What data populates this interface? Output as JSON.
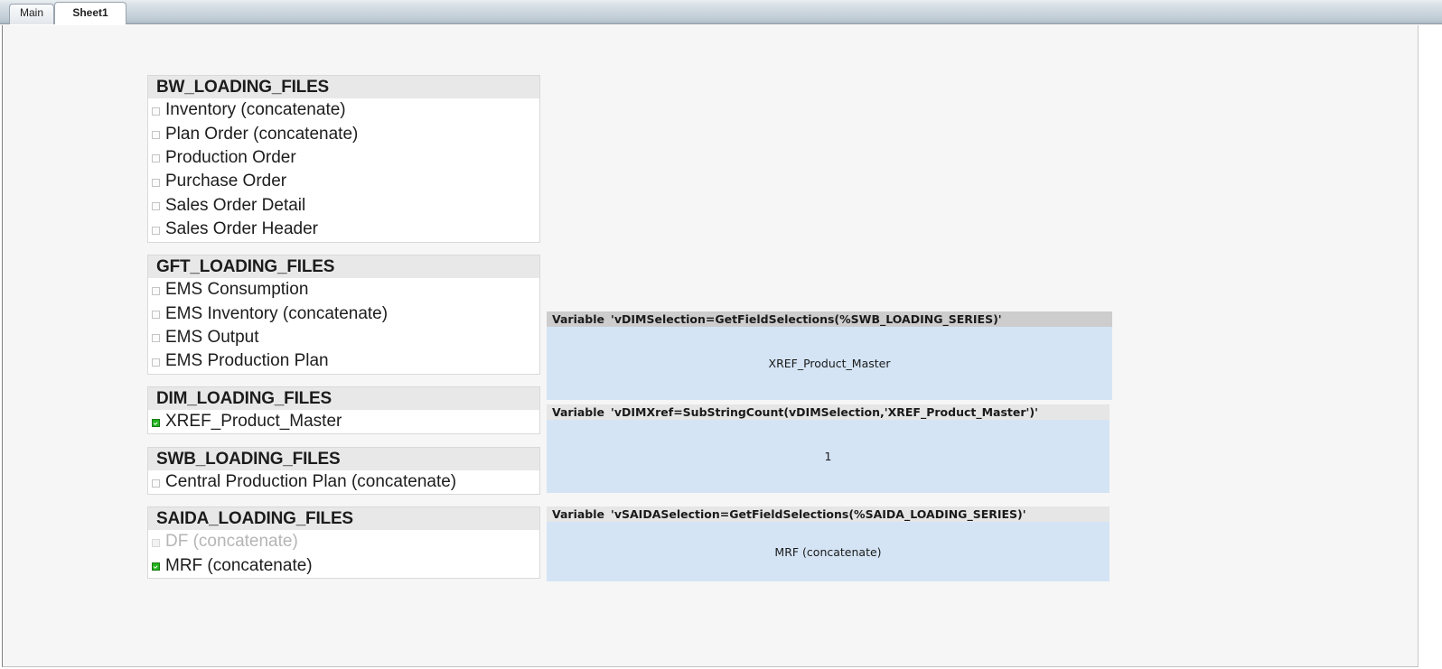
{
  "window": {
    "tabs": [
      {
        "label": "Main",
        "active": false
      },
      {
        "label": "Sheet1",
        "active": true
      }
    ]
  },
  "listboxes": [
    {
      "caption": "BW_LOADING_FILES",
      "items": [
        {
          "label": "Inventory (concatenate)",
          "state": "optional"
        },
        {
          "label": "Plan Order (concatenate)",
          "state": "optional"
        },
        {
          "label": "Production Order",
          "state": "optional"
        },
        {
          "label": "Purchase Order",
          "state": "optional"
        },
        {
          "label": "Sales Order Detail",
          "state": "optional"
        },
        {
          "label": "Sales Order Header",
          "state": "optional"
        }
      ]
    },
    {
      "caption": "GFT_LOADING_FILES",
      "items": [
        {
          "label": "EMS Consumption",
          "state": "optional"
        },
        {
          "label": "EMS Inventory (concatenate)",
          "state": "optional"
        },
        {
          "label": "EMS Output",
          "state": "optional"
        },
        {
          "label": "EMS Production Plan",
          "state": "optional"
        }
      ]
    },
    {
      "caption": "DIM_LOADING_FILES",
      "items": [
        {
          "label": "XREF_Product_Master",
          "state": "selected"
        }
      ]
    },
    {
      "caption": "SWB_LOADING_FILES",
      "items": [
        {
          "label": "Central Production Plan (concatenate)",
          "state": "optional"
        }
      ]
    },
    {
      "caption": "SAIDA_LOADING_FILES",
      "items": [
        {
          "label": "DF (concatenate)",
          "state": "excluded"
        },
        {
          "label": "MRF (concatenate)",
          "state": "selected"
        }
      ]
    }
  ],
  "variable_boxes": [
    {
      "caption_keyword": "Variable",
      "caption_expression": "'vDIMSelection=GetFieldSelections(%SWB_LOADING_SERIES)'",
      "value": "XREF_Product_Master"
    },
    {
      "caption_keyword": "Variable",
      "caption_expression": "'vDIMXref=SubStringCount(vDIMSelection,'XREF_Product_Master')'",
      "value": "1"
    },
    {
      "caption_keyword": "Variable",
      "caption_expression": "'vSAIDASelection=GetFieldSelections(%SAIDA_LOADING_SERIES)'",
      "value": "MRF (concatenate)"
    }
  ],
  "colors": {
    "selected_green": "#22b41c",
    "varbox_body_blue": "#d4e4f5",
    "caption_grey": "#e8e8e8",
    "canvas_grey": "#f6f6f6"
  }
}
